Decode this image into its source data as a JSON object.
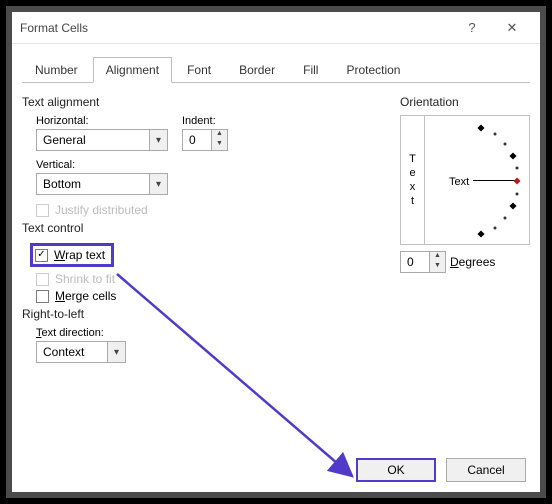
{
  "window": {
    "title": "Format Cells"
  },
  "tabs": {
    "number": "Number",
    "alignment": "Alignment",
    "font": "Font",
    "border": "Border",
    "fill": "Fill",
    "protection": "Protection"
  },
  "alignment": {
    "section": "Text alignment",
    "horizontal_label": "Horizontal:",
    "horizontal_value": "General",
    "vertical_label": "Vertical:",
    "vertical_value": "Bottom",
    "indent_label": "Indent:",
    "indent_value": "0",
    "justify_distributed": "Justify distributed"
  },
  "text_control": {
    "section": "Text control",
    "wrap": "Wrap text",
    "shrink": "Shrink to fit",
    "merge": "Merge cells"
  },
  "rtl": {
    "section": "Right-to-left",
    "direction_label": "Text direction:",
    "direction_value": "Context"
  },
  "orientation": {
    "section": "Orientation",
    "vertical_text": "Text",
    "horiz_text": "Text",
    "degrees_value": "0",
    "degrees_label": "Degrees"
  },
  "buttons": {
    "ok": "OK",
    "cancel": "Cancel"
  }
}
